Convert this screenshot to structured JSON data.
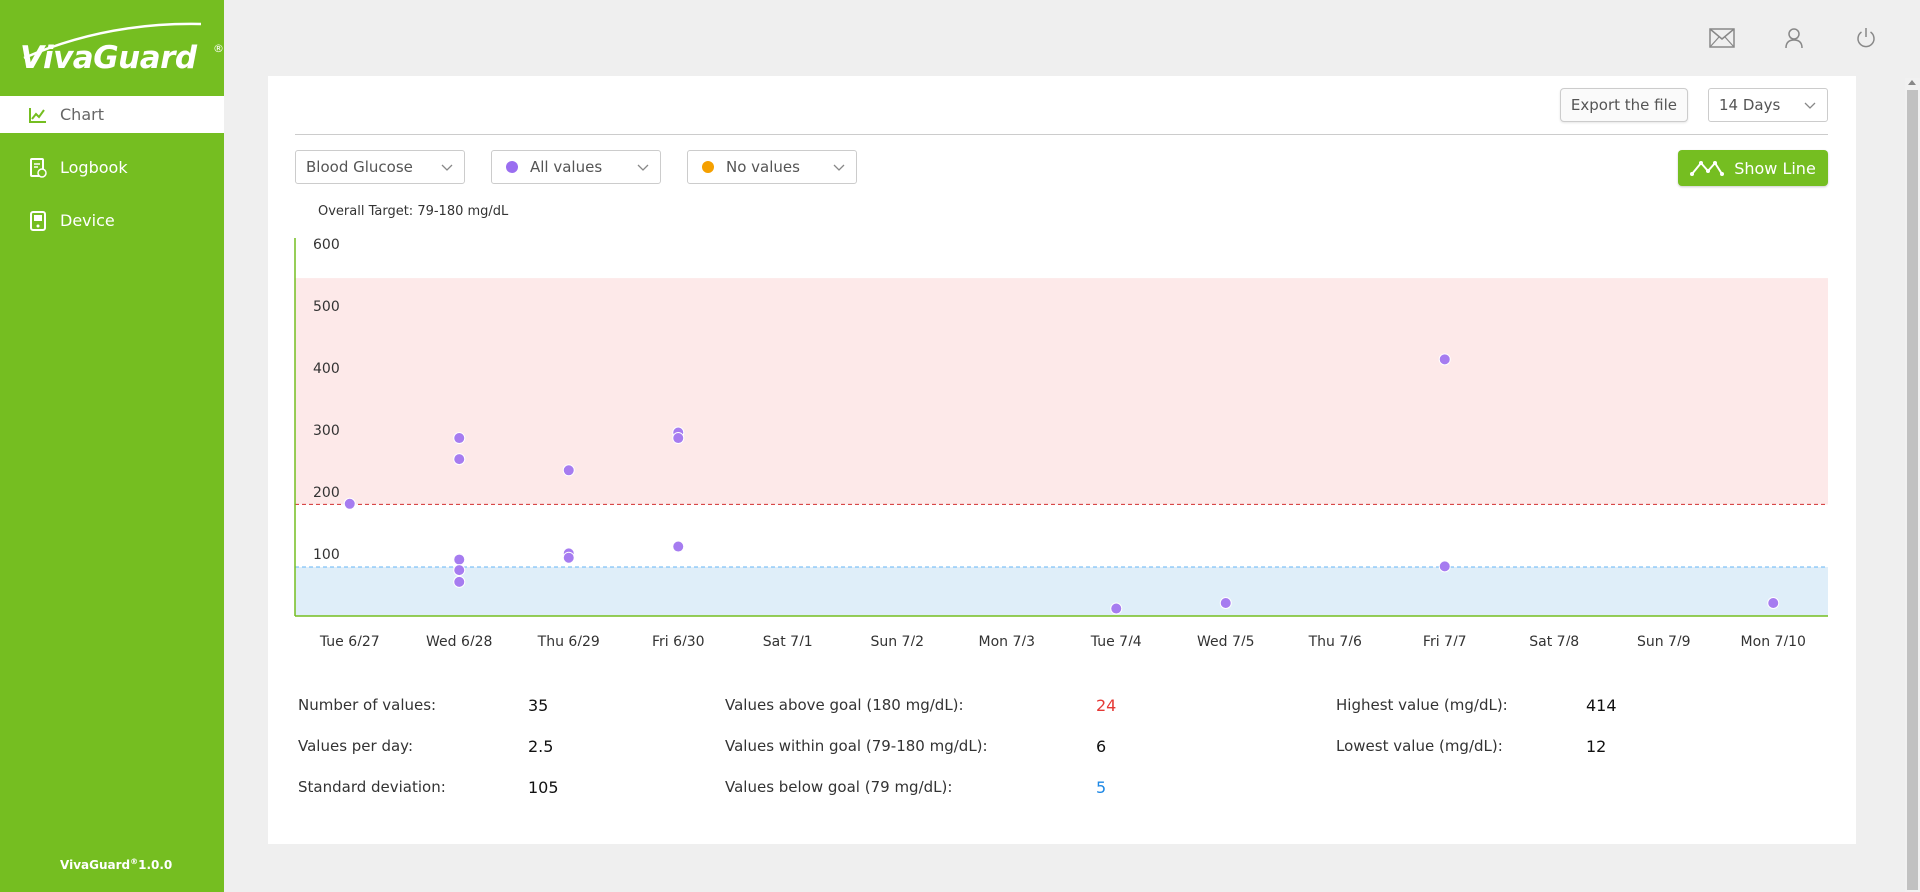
{
  "brand": {
    "logo_text": "VivaGuard",
    "reg_mark": "®",
    "version_name": "VivaGuard",
    "version_num": "1.0.0"
  },
  "nav": [
    {
      "label": "Chart",
      "icon": "chart-icon",
      "active": true
    },
    {
      "label": "Logbook",
      "icon": "logbook-icon",
      "active": false
    },
    {
      "label": "Device",
      "icon": "device-icon",
      "active": false
    }
  ],
  "header_icons": [
    "mail-icon",
    "user-icon",
    "power-icon"
  ],
  "toolbar": {
    "export_label": "Export the file",
    "range_value": "14 Days"
  },
  "filters": {
    "measure": "Blood Glucose",
    "series1": {
      "label": "All values",
      "color": "#9a6ef0"
    },
    "series2": {
      "label": "No values",
      "color": "#f5a000"
    }
  },
  "show_line_label": "Show Line",
  "target_label": "Overall Target: 79-180 mg/dL",
  "colors": {
    "brand": "#75be21",
    "high_band": "#fde9e9",
    "low_band": "#dfeef9",
    "high_line": "#d32f2f",
    "low_line": "#64b5f6",
    "point": "#a67cf0"
  },
  "chart_data": {
    "type": "scatter",
    "ylim": [
      0,
      600
    ],
    "yticks": [
      100,
      200,
      300,
      400,
      500,
      600
    ],
    "target_high": 180,
    "target_low": 79,
    "categories": [
      "Tue 6/27",
      "Wed 6/28",
      "Thu 6/29",
      "Fri 6/30",
      "Sat 7/1",
      "Sun 7/2",
      "Mon 7/3",
      "Tue 7/4",
      "Wed 7/5",
      "Thu 7/6",
      "Fri 7/7",
      "Sat 7/8",
      "Sun 7/9",
      "Mon 7/10"
    ],
    "series": [
      {
        "points": [
          {
            "x": "Tue 6/27",
            "y": 181
          },
          {
            "x": "Wed 6/28",
            "y": 287
          },
          {
            "x": "Wed 6/28",
            "y": 253
          },
          {
            "x": "Wed 6/28",
            "y": 91
          },
          {
            "x": "Wed 6/28",
            "y": 74
          },
          {
            "x": "Wed 6/28",
            "y": 55
          },
          {
            "x": "Thu 6/29",
            "y": 235
          },
          {
            "x": "Thu 6/29",
            "y": 101
          },
          {
            "x": "Thu 6/29",
            "y": 94
          },
          {
            "x": "Fri 6/30",
            "y": 296
          },
          {
            "x": "Fri 6/30",
            "y": 287
          },
          {
            "x": "Fri 6/30",
            "y": 112
          },
          {
            "x": "Tue 7/4",
            "y": 12
          },
          {
            "x": "Wed 7/5",
            "y": 21
          },
          {
            "x": "Fri 7/7",
            "y": 414
          },
          {
            "x": "Fri 7/7",
            "y": 80
          },
          {
            "x": "Mon 7/10",
            "y": 21
          }
        ]
      }
    ]
  },
  "stats": {
    "count_label": "Number of values:",
    "count": "35",
    "per_day_label": "Values per day:",
    "per_day": "2.5",
    "std_label": "Standard deviation:",
    "std": "105",
    "above_label": "Values above goal (180 mg/dL):",
    "above": "24",
    "within_label": "Values within goal (79-180 mg/dL):",
    "within": "6",
    "below_label": "Values below goal (79 mg/dL):",
    "below": "5",
    "highest_label": "Highest value (mg/dL):",
    "highest": "414",
    "lowest_label": "Lowest value (mg/dL):",
    "lowest": "12"
  }
}
